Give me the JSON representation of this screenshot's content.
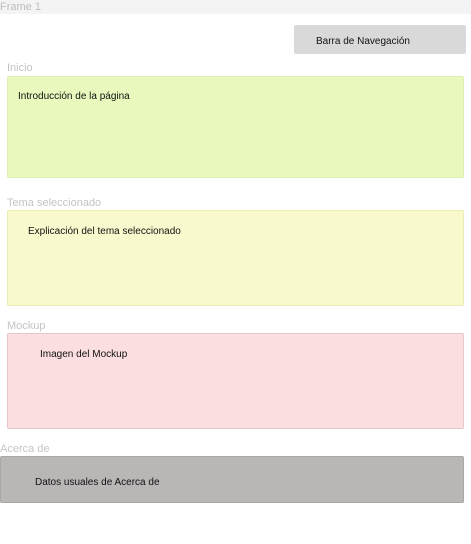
{
  "frame": {
    "title": "Frame 1"
  },
  "navbar": {
    "label": "Barra de Navegación"
  },
  "sections": {
    "inicio": {
      "title": "Inicio",
      "content": "Introducción de la página"
    },
    "tema": {
      "title": "Tema seleccionado",
      "content": "Explicación del tema seleccionado"
    },
    "mockup": {
      "title": "Mockup",
      "content": "Imagen del Mockup"
    },
    "acerca": {
      "title": "Acerca de",
      "content": "Datos usuales de Acerca de"
    }
  },
  "colors": {
    "navbar": "#d9d9d9",
    "inicio": "#e9f8bc",
    "tema": "#f8f9cd",
    "mockup": "#fbdfe0",
    "acerca": "#b9b6b6"
  }
}
